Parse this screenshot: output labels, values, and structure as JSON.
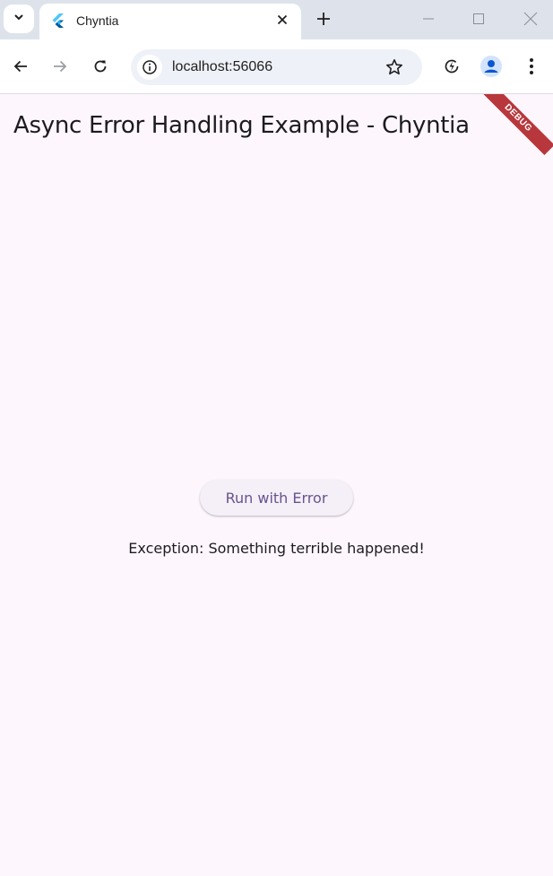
{
  "browser": {
    "tab": {
      "title": "Chyntia"
    },
    "address": {
      "url": "localhost:56066"
    },
    "icons": [
      "tab-search-icon",
      "flutter-favicon-icon",
      "close-icon",
      "new-tab-icon",
      "minimize-icon",
      "maximize-icon",
      "window-close-icon",
      "back-icon",
      "forward-icon",
      "reload-icon",
      "site-info-icon",
      "bookmark-star-icon",
      "performance-icon",
      "profile-icon",
      "more-menu-icon"
    ]
  },
  "app": {
    "title": "Async Error Handling Example - Chyntia",
    "debug_banner": "DEBUG",
    "run_button": "Run with Error",
    "error_message": "Exception: Something terrible happened!"
  },
  "colors": {
    "background": "#fdf7fd",
    "button_text": "#65558f",
    "debug_banner": "#b7373c"
  }
}
